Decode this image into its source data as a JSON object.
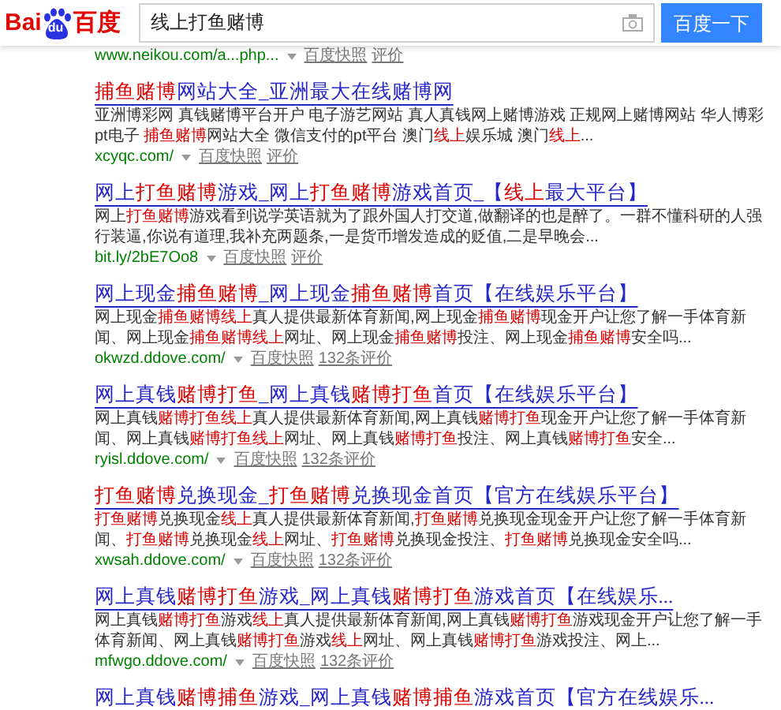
{
  "header": {
    "logo": {
      "latin": "Bai",
      "paw": "du",
      "chinese": "百度"
    },
    "search": {
      "value": "线上打鱼赌博"
    },
    "button": "百度一下"
  },
  "results": [
    {
      "url": "www.neikou.com/a...php...",
      "snapshot": "百度快照",
      "rating": "评价"
    },
    {
      "title": [
        {
          "text": "捕鱼赌博",
          "highlight": true
        },
        {
          "text": "网站大全_亚洲最大在线赌博网",
          "highlight": false
        }
      ],
      "snippet": [
        {
          "text": "亚洲博彩网 真钱赌博平台开户 电子游艺网站 真人真钱网上赌博游戏 正规网上赌博网站 华人博彩pt电子 ",
          "highlight": false
        },
        {
          "text": "捕鱼赌博",
          "highlight": true
        },
        {
          "text": "网站大全 微信支付的pt平台 澳门",
          "highlight": false
        },
        {
          "text": "线上",
          "highlight": true
        },
        {
          "text": "娱乐城 澳门",
          "highlight": false
        },
        {
          "text": "线上",
          "highlight": true
        },
        {
          "text": "...",
          "highlight": false
        }
      ],
      "url": "xcyqc.com/",
      "snapshot": "百度快照",
      "rating": "评价"
    },
    {
      "title": [
        {
          "text": "网上",
          "highlight": false
        },
        {
          "text": "打鱼赌博",
          "highlight": true
        },
        {
          "text": "游戏_网上",
          "highlight": false
        },
        {
          "text": "打鱼赌博",
          "highlight": true
        },
        {
          "text": "游戏首页_【",
          "highlight": false
        },
        {
          "text": "线上",
          "highlight": true
        },
        {
          "text": "最大平台】",
          "highlight": false
        }
      ],
      "snippet": [
        {
          "text": "网上",
          "highlight": false
        },
        {
          "text": "打鱼赌博",
          "highlight": true
        },
        {
          "text": "游戏看到说学英语就为了跟外国人打交道,做翻译的也是醉了。一群不懂科研的人强行装逼,你说有道理,我补充两题条,一是货币增发造成的贬值,二是早晚会...",
          "highlight": false
        }
      ],
      "url": "bit.ly/2bE7Oo8",
      "snapshot": "百度快照",
      "rating": "评价"
    },
    {
      "title": [
        {
          "text": "网上现金",
          "highlight": false
        },
        {
          "text": "捕鱼赌博",
          "highlight": true
        },
        {
          "text": "_网上现金",
          "highlight": false
        },
        {
          "text": "捕鱼赌博",
          "highlight": true
        },
        {
          "text": "首页【在线娱乐平台】",
          "highlight": false
        }
      ],
      "snippet": [
        {
          "text": "网上现金",
          "highlight": false
        },
        {
          "text": "捕鱼赌博线上",
          "highlight": true
        },
        {
          "text": "真人提供最新体育新闻,网上现金",
          "highlight": false
        },
        {
          "text": "捕鱼赌博",
          "highlight": true
        },
        {
          "text": "现金开户让您了解一手体育新闻、网上现金",
          "highlight": false
        },
        {
          "text": "捕鱼赌博线上",
          "highlight": true
        },
        {
          "text": "网址、网上现金",
          "highlight": false
        },
        {
          "text": "捕鱼赌博",
          "highlight": true
        },
        {
          "text": "投注、网上现金",
          "highlight": false
        },
        {
          "text": "捕鱼赌博",
          "highlight": true
        },
        {
          "text": "安全吗...",
          "highlight": false
        }
      ],
      "url": "okwzd.ddove.com/",
      "snapshot": "百度快照",
      "rating": "132条评价"
    },
    {
      "title": [
        {
          "text": "网上真钱",
          "highlight": false
        },
        {
          "text": "赌博打鱼",
          "highlight": true
        },
        {
          "text": "_网上真钱",
          "highlight": false
        },
        {
          "text": "赌博打鱼",
          "highlight": true
        },
        {
          "text": "首页【在线娱乐平台】",
          "highlight": false
        }
      ],
      "snippet": [
        {
          "text": "网上真钱",
          "highlight": false
        },
        {
          "text": "赌博打鱼线上",
          "highlight": true
        },
        {
          "text": "真人提供最新体育新闻,网上真钱",
          "highlight": false
        },
        {
          "text": "赌博打鱼",
          "highlight": true
        },
        {
          "text": "现金开户让您了解一手体育新闻、网上真钱",
          "highlight": false
        },
        {
          "text": "赌博打鱼线上",
          "highlight": true
        },
        {
          "text": "网址、网上真钱",
          "highlight": false
        },
        {
          "text": "赌博打鱼",
          "highlight": true
        },
        {
          "text": "投注、网上真钱",
          "highlight": false
        },
        {
          "text": "赌博打鱼",
          "highlight": true
        },
        {
          "text": "安全...",
          "highlight": false
        }
      ],
      "url": "ryisl.ddove.com/",
      "snapshot": "百度快照",
      "rating": "132条评价"
    },
    {
      "title": [
        {
          "text": "打鱼赌博",
          "highlight": true
        },
        {
          "text": "兑换现金_",
          "highlight": false
        },
        {
          "text": "打鱼赌博",
          "highlight": true
        },
        {
          "text": "兑换现金首页【官方在线娱乐平台】",
          "highlight": false
        }
      ],
      "snippet": [
        {
          "text": "打鱼赌博",
          "highlight": true
        },
        {
          "text": "兑换现金",
          "highlight": false
        },
        {
          "text": "线上",
          "highlight": true
        },
        {
          "text": "真人提供最新体育新闻,",
          "highlight": false
        },
        {
          "text": "打鱼赌博",
          "highlight": true
        },
        {
          "text": "兑换现金现金开户让您了解一手体育新闻、",
          "highlight": false
        },
        {
          "text": "打鱼赌博",
          "highlight": true
        },
        {
          "text": "兑换现金",
          "highlight": false
        },
        {
          "text": "线上",
          "highlight": true
        },
        {
          "text": "网址、",
          "highlight": false
        },
        {
          "text": "打鱼赌博",
          "highlight": true
        },
        {
          "text": "兑换现金投注、",
          "highlight": false
        },
        {
          "text": "打鱼赌博",
          "highlight": true
        },
        {
          "text": "兑换现金安全吗...",
          "highlight": false
        }
      ],
      "url": "xwsah.ddove.com/",
      "snapshot": "百度快照",
      "rating": "132条评价"
    },
    {
      "title": [
        {
          "text": "网上真钱",
          "highlight": false
        },
        {
          "text": "赌博打鱼",
          "highlight": true
        },
        {
          "text": "游戏_网上真钱",
          "highlight": false
        },
        {
          "text": "赌博打鱼",
          "highlight": true
        },
        {
          "text": "游戏首页【在线娱乐...",
          "highlight": false
        }
      ],
      "snippet": [
        {
          "text": "网上真钱",
          "highlight": false
        },
        {
          "text": "赌博打鱼",
          "highlight": true
        },
        {
          "text": "游戏",
          "highlight": false
        },
        {
          "text": "线上",
          "highlight": true
        },
        {
          "text": "真人提供最新体育新闻,网上真钱",
          "highlight": false
        },
        {
          "text": "赌博打鱼",
          "highlight": true
        },
        {
          "text": "游戏现金开户让您了解一手体育新闻、网上真钱",
          "highlight": false
        },
        {
          "text": "赌博打鱼",
          "highlight": true
        },
        {
          "text": "游戏",
          "highlight": false
        },
        {
          "text": "线上",
          "highlight": true
        },
        {
          "text": "网址、网上真钱",
          "highlight": false
        },
        {
          "text": "赌博打鱼",
          "highlight": true
        },
        {
          "text": "游戏投注、网上...",
          "highlight": false
        }
      ],
      "url": "mfwgo.ddove.com/",
      "snapshot": "百度快照",
      "rating": "132条评价"
    },
    {
      "title": [
        {
          "text": "网上真钱",
          "highlight": false
        },
        {
          "text": "赌博捕鱼",
          "highlight": true
        },
        {
          "text": "游戏_网上真钱",
          "highlight": false
        },
        {
          "text": "赌博捕鱼",
          "highlight": true
        },
        {
          "text": "游戏首页【官方在线娱乐...",
          "highlight": false
        }
      ]
    }
  ]
}
